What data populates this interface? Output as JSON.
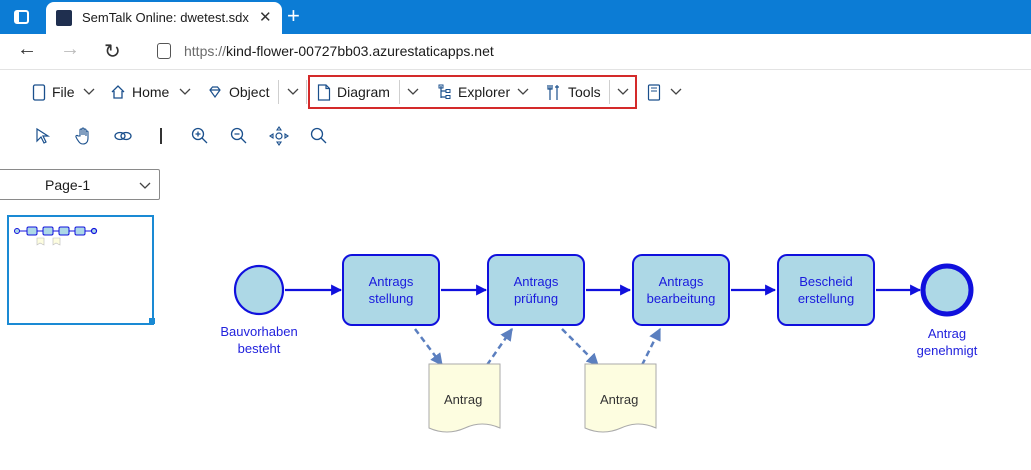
{
  "browser": {
    "tab_title": "SemTalk Online: dwetest.sdx",
    "url_scheme": "https://",
    "url_host": "kind-flower-00727bb03.azurestaticapps.net"
  },
  "ribbon": {
    "menus": [
      {
        "label": "File",
        "icon": "file-icon"
      },
      {
        "label": "Home",
        "icon": "home-icon"
      },
      {
        "label": "Object",
        "icon": "diamond-icon"
      },
      {
        "label": "Diagram",
        "icon": "document-icon"
      },
      {
        "label": "Explorer",
        "icon": "tree-icon"
      },
      {
        "label": "Tools",
        "icon": "tools-icon"
      },
      {
        "label": "",
        "icon": "book-icon"
      }
    ],
    "tools": [
      "pointer-icon",
      "hand-icon",
      "link-icon",
      "divider",
      "zoom-in-icon",
      "zoom-out-icon",
      "fit-icon",
      "search-icon"
    ]
  },
  "pages": {
    "selected": "Page-1"
  },
  "diagram": {
    "start_event": "Bauvorhaben besteht",
    "end_event": "Antrag genehmigt",
    "processes": [
      "Antrags stellung",
      "Antrags prüfung",
      "Antrags bearbeitung",
      "Bescheid erstellung"
    ],
    "documents": [
      "Antrag",
      "Antrag"
    ],
    "colors": {
      "process_fill": "#add8e6",
      "process_border": "#1010dd",
      "flow": "#1010dd",
      "data_flow": "#5b7fbf",
      "document_fill": "#fdfde0",
      "highlight": "#d42a2a",
      "titlebar": "#0c7cd5"
    }
  }
}
